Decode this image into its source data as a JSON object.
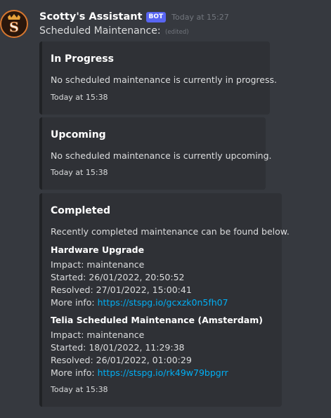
{
  "message": {
    "author": "Scotty's Assistant",
    "bot_tag": "BOT",
    "timestamp": "Today at 15:27",
    "content": "Scheduled Maintenance:",
    "edited": "(edited)"
  },
  "embeds": [
    {
      "title": "In Progress",
      "description": "No scheduled maintenance is currently in progress.",
      "footer": "Today at 15:38"
    },
    {
      "title": "Upcoming",
      "description": "No scheduled maintenance is currently upcoming.",
      "footer": "Today at 15:38"
    },
    {
      "title": "Completed",
      "description": "Recently completed maintenance can be found below.",
      "fields": [
        {
          "name": "Hardware Upgrade",
          "impact": "Impact: maintenance",
          "started": "Started: 26/01/2022, 20:50:52",
          "resolved": "Resolved: 27/01/2022, 15:00:41",
          "more_info_label": "More info:",
          "link": "https://stspg.io/gcxzk0n5fh07"
        },
        {
          "name": "Telia Scheduled Maintenance (Amsterdam)",
          "impact": "Impact: maintenance",
          "started": "Started: 18/01/2022, 11:29:38",
          "resolved": "Resolved: 26/01/2022, 01:00:29",
          "more_info_label": "More info:",
          "link": "https://stspg.io/rk49w79bpgrr"
        }
      ],
      "footer": "Today at 15:38"
    }
  ],
  "colors": {
    "background": "#36393f",
    "embed_background": "#2f3136",
    "embed_border": "#202225",
    "bot_tag": "#5865f2",
    "link": "#00aff4"
  },
  "icons": {
    "avatar": "scotty-s-logo-avatar"
  }
}
